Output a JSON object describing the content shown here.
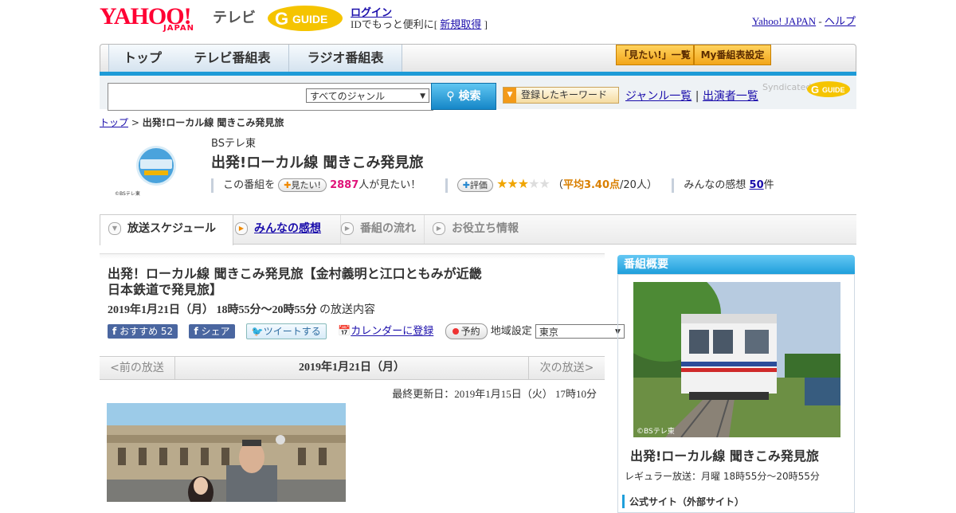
{
  "header": {
    "brand": "YAHOO!",
    "brand_sub": "JAPAN",
    "service": "テレビ",
    "gguide_logo": "G GUIDE",
    "login_label": "ログイン",
    "login_desc": "IDでもっと便利に[",
    "signup_label": "新規取得",
    "signup_close": "]",
    "yahoo_japan_link": "Yahoo! JAPAN",
    "separator": "-",
    "help_link": "ヘルプ"
  },
  "nav": {
    "tabs": [
      {
        "label": "トップ"
      },
      {
        "label": "テレビ番組表"
      },
      {
        "label": "ラジオ番組表"
      }
    ],
    "want_list_label": "「見たい!」一覧",
    "my_schedule_label": "My番組表設定"
  },
  "search": {
    "input_value": "",
    "genre_selected": "すべてのジャンル",
    "search_button": "検索",
    "keyword_button": "登録したキーワード",
    "genre_list_link": "ジャンル一覧",
    "link_sep": "|",
    "cast_list_link": "出演者一覧",
    "syndicated": "Syndicated"
  },
  "breadcrumb": {
    "top": "トップ",
    "sep": ">",
    "current": "出発!ローカル線 聞きこみ発見旅"
  },
  "program": {
    "thumb_caption": "©BSテレ東",
    "channel": "BSテレ東",
    "title": "出発!ローカル線 聞きこみ発見旅",
    "want_prefix": "この番組を",
    "want_button": "見たい!",
    "want_count": "2887",
    "want_suffix": "人が見たい！",
    "rate_button": "評価",
    "rating_stars": 3,
    "rating_max": 5,
    "avg_open": "（",
    "avg_label": "平均3.40点",
    "avg_count": "/20人）",
    "comments_label": "みんなの感想",
    "comments_count": "50",
    "comments_unit": "件"
  },
  "tabs": [
    {
      "label": "放送スケジュール"
    },
    {
      "label": "みんなの感想"
    },
    {
      "label": "番組の流れ"
    },
    {
      "label": "お役立ち情報"
    }
  ],
  "episode": {
    "title": "出発！ローカル線 聞きこみ発見旅【金村義明と江口ともみが近畿日本鉄道で発見旅】",
    "date": "2019年1月21日（月）",
    "time": "18時55分～20時55分",
    "content_label": "の放送内容",
    "fb_recommend": "おすすめ",
    "fb_count": "52",
    "fb_share": "シェア",
    "tweet": "ツイートする",
    "calendar": "カレンダーに登録",
    "reserve": "予約",
    "region_label": "地域設定",
    "region_value": "東京",
    "prev": "<前の放送",
    "current_date": "2019年1月21日（月）",
    "next": "次の放送>",
    "updated": "最終更新日：2019年1月15日（火） 17時10分"
  },
  "sidebar": {
    "heading": "番組概要",
    "photo_caption": "©BSテレ東",
    "title": "出発!ローカル線 聞きこみ発見旅",
    "regular": "レギュラー放送：月曜 18時55分～20時55分",
    "official_site": "公式サイト（外部サイト）"
  },
  "colors": {
    "accent_blue": "#1e9bd7",
    "yahoo_red": "#ff0033",
    "link": "#1a0dab",
    "want_pink": "#e0147a",
    "star_gold": "#f0a500"
  }
}
